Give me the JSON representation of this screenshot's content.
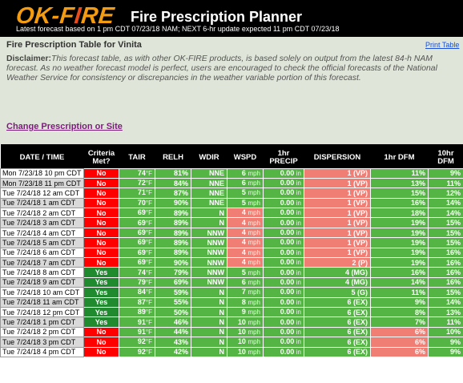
{
  "header": {
    "logo_text_1": "OK-F",
    "logo_text_2": "I",
    "logo_text_3": "RE",
    "app_title": "Fire Prescription Planner",
    "subline": "Latest forecast based on 1 pm CDT 07/23/18 NAM; NEXT 6-hr update expected 11 pm CDT 07/23/18"
  },
  "panel": {
    "title": "Fire Prescription Table for Vinita",
    "print_link": "Print Table",
    "disclaimer_label": "Disclaimer:",
    "disclaimer_text": "This forecast table, as with other OK-FIRE products, is based solely on output from the latest 84-h NAM forecast. As no weather forecast model is perfect, users are encouraged to check the official forecasts of the National Weather Service for consistency or discrepancies in the weather variable portion of this forecast.",
    "change_link": "Change Prescription or Site"
  },
  "columns": {
    "date": "DATE / TIME",
    "crit1": "Criteria",
    "crit2": "Met?",
    "tair": "TAIR",
    "relh": "RELH",
    "wdir": "WDIR",
    "wspd": "WSPD",
    "precip1": "1hr",
    "precip2": "PRECIP",
    "dispersion": "DISPERSION",
    "dfm1": "1hr DFM",
    "dfm10a": "10hr",
    "dfm10b": "DFM"
  },
  "colors": {
    "green": "#55b544",
    "dark_green": "#1f8a2e",
    "red": "#ff0000",
    "pink": "#f07e74",
    "accent_orange": "#f39c12"
  },
  "rows": [
    {
      "dt": "Mon 7/23/18 10 pm CDT",
      "met": "No",
      "tair": "74",
      "relh": "81%",
      "wdir": "NNE",
      "wspd": "6",
      "wspd_ok": true,
      "precip": "0.00",
      "disp": "1 (VP)",
      "disp_ok": false,
      "dfm1": "11%",
      "dfm1_ok": true,
      "dfm10": "9%"
    },
    {
      "dt": "Mon 7/23/18 11 pm CDT",
      "met": "No",
      "tair": "72",
      "relh": "84%",
      "wdir": "NNE",
      "wspd": "6",
      "wspd_ok": true,
      "precip": "0.00",
      "disp": "1 (VP)",
      "disp_ok": false,
      "dfm1": "13%",
      "dfm1_ok": true,
      "dfm10": "11%"
    },
    {
      "dt": "Tue 7/24/18 12 am CDT",
      "met": "No",
      "tair": "71",
      "relh": "87%",
      "wdir": "NNE",
      "wspd": "5",
      "wspd_ok": true,
      "precip": "0.00",
      "disp": "1 (VP)",
      "disp_ok": false,
      "dfm1": "15%",
      "dfm1_ok": true,
      "dfm10": "12%"
    },
    {
      "dt": "Tue 7/24/18 1 am CDT",
      "met": "No",
      "tair": "70",
      "relh": "90%",
      "wdir": "NNE",
      "wspd": "5",
      "wspd_ok": true,
      "precip": "0.00",
      "disp": "1 (VP)",
      "disp_ok": false,
      "dfm1": "16%",
      "dfm1_ok": true,
      "dfm10": "14%"
    },
    {
      "dt": "Tue 7/24/18 2 am CDT",
      "met": "No",
      "tair": "69",
      "relh": "89%",
      "wdir": "N",
      "wspd": "4",
      "wspd_ok": false,
      "precip": "0.00",
      "disp": "1 (VP)",
      "disp_ok": false,
      "dfm1": "18%",
      "dfm1_ok": true,
      "dfm10": "14%"
    },
    {
      "dt": "Tue 7/24/18 3 am CDT",
      "met": "No",
      "tair": "69",
      "relh": "89%",
      "wdir": "N",
      "wspd": "4",
      "wspd_ok": false,
      "precip": "0.00",
      "disp": "1 (VP)",
      "disp_ok": false,
      "dfm1": "19%",
      "dfm1_ok": true,
      "dfm10": "15%"
    },
    {
      "dt": "Tue 7/24/18 4 am CDT",
      "met": "No",
      "tair": "69",
      "relh": "89%",
      "wdir": "NNW",
      "wspd": "4",
      "wspd_ok": false,
      "precip": "0.00",
      "disp": "1 (VP)",
      "disp_ok": false,
      "dfm1": "19%",
      "dfm1_ok": true,
      "dfm10": "15%"
    },
    {
      "dt": "Tue 7/24/18 5 am CDT",
      "met": "No",
      "tair": "69",
      "relh": "89%",
      "wdir": "NNW",
      "wspd": "4",
      "wspd_ok": false,
      "precip": "0.00",
      "disp": "1 (VP)",
      "disp_ok": false,
      "dfm1": "19%",
      "dfm1_ok": true,
      "dfm10": "15%"
    },
    {
      "dt": "Tue 7/24/18 6 am CDT",
      "met": "No",
      "tair": "69",
      "relh": "89%",
      "wdir": "NNW",
      "wspd": "4",
      "wspd_ok": false,
      "precip": "0.00",
      "disp": "1 (VP)",
      "disp_ok": false,
      "dfm1": "19%",
      "dfm1_ok": true,
      "dfm10": "16%"
    },
    {
      "dt": "Tue 7/24/18 7 am CDT",
      "met": "No",
      "tair": "69",
      "relh": "90%",
      "wdir": "NNW",
      "wspd": "4",
      "wspd_ok": false,
      "precip": "0.00",
      "disp": "2 (P)",
      "disp_ok": false,
      "dfm1": "19%",
      "dfm1_ok": true,
      "dfm10": "16%"
    },
    {
      "dt": "Tue 7/24/18 8 am CDT",
      "met": "Yes",
      "tair": "74",
      "relh": "79%",
      "wdir": "NNW",
      "wspd": "5",
      "wspd_ok": true,
      "precip": "0.00",
      "disp": "4 (MG)",
      "disp_ok": true,
      "dfm1": "16%",
      "dfm1_ok": true,
      "dfm10": "16%"
    },
    {
      "dt": "Tue 7/24/18 9 am CDT",
      "met": "Yes",
      "tair": "79",
      "relh": "69%",
      "wdir": "NNW",
      "wspd": "6",
      "wspd_ok": true,
      "precip": "0.00",
      "disp": "4 (MG)",
      "disp_ok": true,
      "dfm1": "14%",
      "dfm1_ok": true,
      "dfm10": "16%"
    },
    {
      "dt": "Tue 7/24/18 10 am CDT",
      "met": "Yes",
      "tair": "84",
      "relh": "59%",
      "wdir": "N",
      "wspd": "7",
      "wspd_ok": true,
      "precip": "0.00",
      "disp": "5 (G)",
      "disp_ok": true,
      "dfm1": "11%",
      "dfm1_ok": true,
      "dfm10": "15%"
    },
    {
      "dt": "Tue 7/24/18 11 am CDT",
      "met": "Yes",
      "tair": "87",
      "relh": "55%",
      "wdir": "N",
      "wspd": "8",
      "wspd_ok": true,
      "precip": "0.00",
      "disp": "6 (EX)",
      "disp_ok": true,
      "dfm1": "9%",
      "dfm1_ok": true,
      "dfm10": "14%"
    },
    {
      "dt": "Tue 7/24/18 12 pm CDT",
      "met": "Yes",
      "tair": "89",
      "relh": "50%",
      "wdir": "N",
      "wspd": "9",
      "wspd_ok": true,
      "precip": "0.00",
      "disp": "6 (EX)",
      "disp_ok": true,
      "dfm1": "8%",
      "dfm1_ok": true,
      "dfm10": "13%"
    },
    {
      "dt": "Tue 7/24/18 1 pm CDT",
      "met": "Yes",
      "tair": "91",
      "relh": "46%",
      "wdir": "N",
      "wspd": "10",
      "wspd_ok": true,
      "precip": "0.00",
      "disp": "6 (EX)",
      "disp_ok": true,
      "dfm1": "7%",
      "dfm1_ok": true,
      "dfm10": "11%"
    },
    {
      "dt": "Tue 7/24/18 2 pm CDT",
      "met": "No",
      "tair": "91",
      "relh": "44%",
      "wdir": "N",
      "wspd": "10",
      "wspd_ok": true,
      "precip": "0.00",
      "disp": "6 (EX)",
      "disp_ok": true,
      "dfm1": "6%",
      "dfm1_ok": false,
      "dfm10": "10%"
    },
    {
      "dt": "Tue 7/24/18 3 pm CDT",
      "met": "No",
      "tair": "92",
      "relh": "43%",
      "wdir": "N",
      "wspd": "10",
      "wspd_ok": true,
      "precip": "0.00",
      "disp": "6 (EX)",
      "disp_ok": true,
      "dfm1": "6%",
      "dfm1_ok": false,
      "dfm10": "9%"
    },
    {
      "dt": "Tue 7/24/18 4 pm CDT",
      "met": "No",
      "tair": "92",
      "relh": "42%",
      "wdir": "N",
      "wspd": "10",
      "wspd_ok": true,
      "precip": "0.00",
      "disp": "6 (EX)",
      "disp_ok": true,
      "dfm1": "6%",
      "dfm1_ok": false,
      "dfm10": "9%"
    }
  ],
  "units": {
    "temp": "°F",
    "speed": "mph",
    "precip": "in"
  }
}
